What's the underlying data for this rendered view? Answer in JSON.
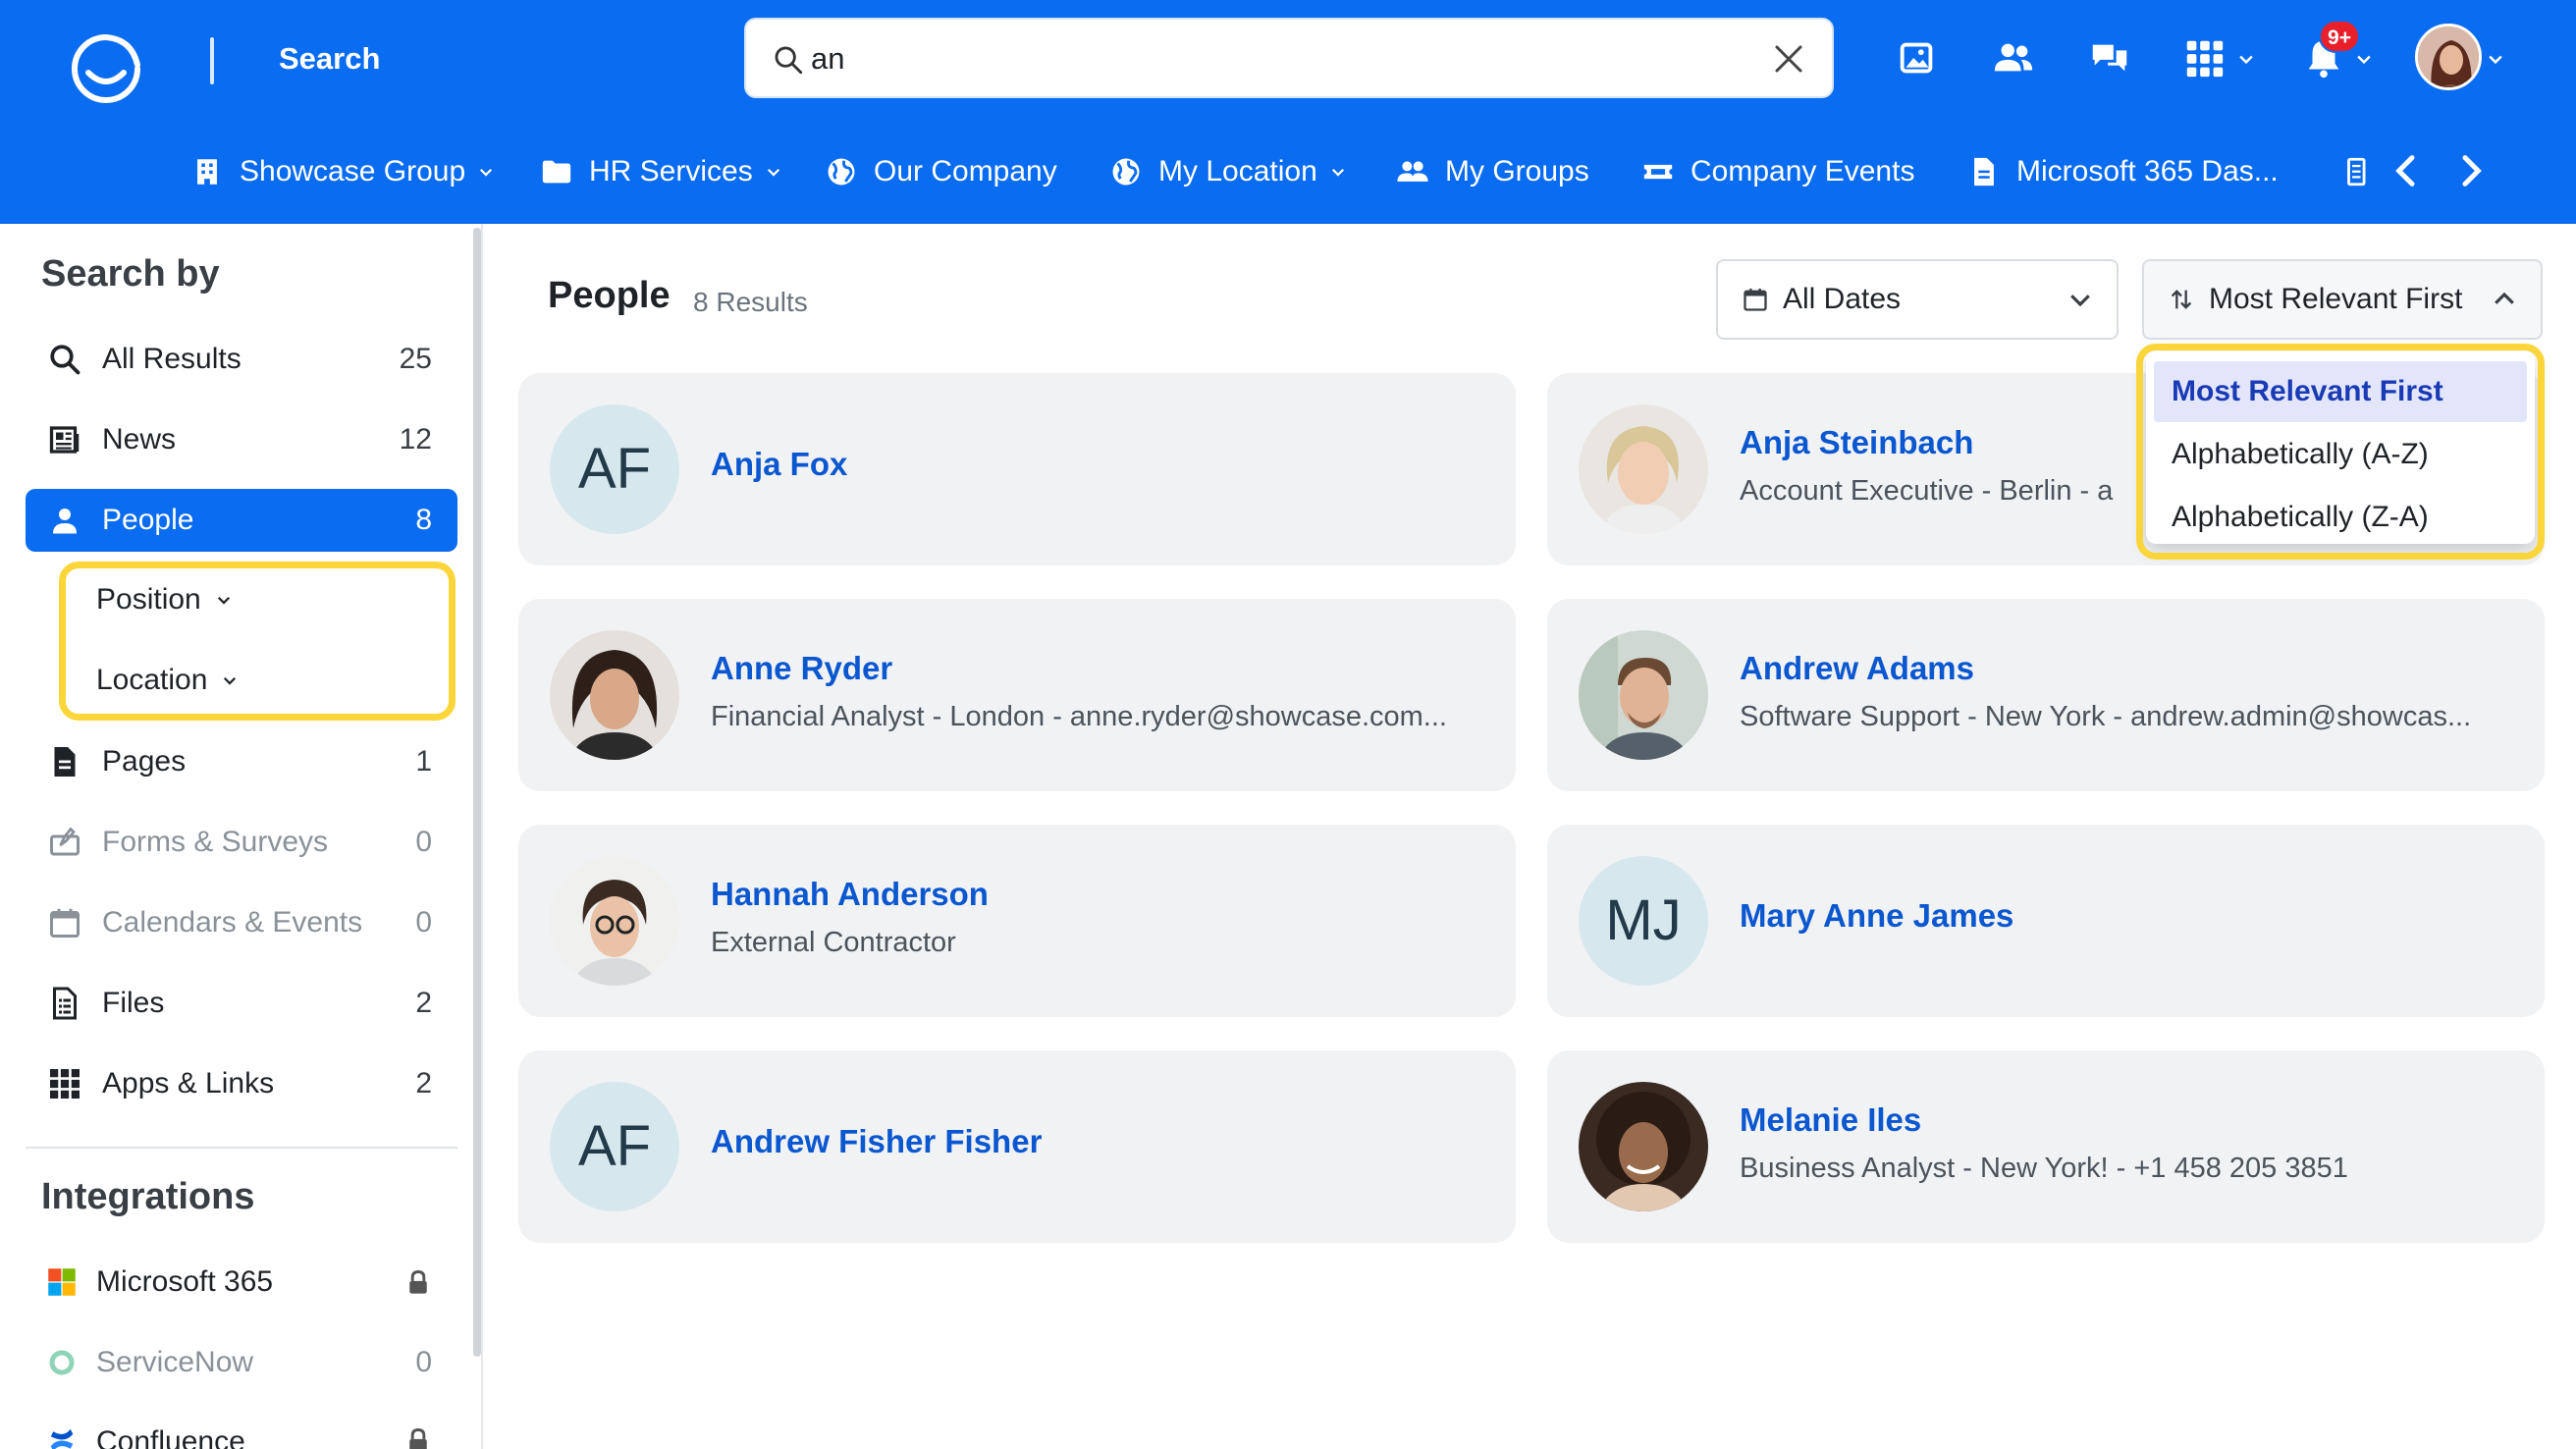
{
  "header": {
    "title": "Search",
    "search": {
      "value": "an",
      "placeholder": ""
    },
    "notification_badge": "9+",
    "brand_color": "#0a6cf0"
  },
  "nav": {
    "items": [
      {
        "label": "Showcase Group",
        "icon": "building-icon",
        "has_dropdown": true
      },
      {
        "label": "HR Services",
        "icon": "folder-icon",
        "has_dropdown": true
      },
      {
        "label": "Our Company",
        "icon": "globe-icon",
        "has_dropdown": false
      },
      {
        "label": "My Location",
        "icon": "globe-icon",
        "has_dropdown": true
      },
      {
        "label": "My Groups",
        "icon": "users-icon",
        "has_dropdown": false
      },
      {
        "label": "Company Events",
        "icon": "ticket-icon",
        "has_dropdown": false
      },
      {
        "label": "Microsoft 365 Das...",
        "icon": "document-icon",
        "has_dropdown": false
      }
    ]
  },
  "sidebar": {
    "heading": "Search by",
    "items": [
      {
        "label": "All Results",
        "count": "25",
        "icon": "search-icon"
      },
      {
        "label": "News",
        "count": "12",
        "icon": "newspaper-icon"
      },
      {
        "label": "People",
        "count": "8",
        "icon": "person-icon",
        "active": true
      },
      {
        "label": "Pages",
        "count": "1",
        "icon": "page-icon"
      },
      {
        "label": "Forms & Surveys",
        "count": "0",
        "icon": "form-icon"
      },
      {
        "label": "Calendars & Events",
        "count": "0",
        "icon": "calendar-icon"
      },
      {
        "label": "Files",
        "count": "2",
        "icon": "file-icon"
      },
      {
        "label": "Apps & Links",
        "count": "2",
        "icon": "grid-icon"
      }
    ],
    "filters": [
      {
        "label": "Position"
      },
      {
        "label": "Location"
      }
    ],
    "integrations_heading": "Integrations",
    "integrations": [
      {
        "label": "Microsoft 365",
        "status": "locked"
      },
      {
        "label": "ServiceNow",
        "count": "0"
      },
      {
        "label": "Confluence",
        "status": "locked"
      }
    ]
  },
  "main": {
    "title": "People",
    "result_count": "8 Results",
    "date_filter": "All Dates",
    "sort": {
      "selected": "Most Relevant First",
      "options": [
        "Most Relevant First",
        "Alphabetically (A-Z)",
        "Alphabetically (Z-A)"
      ]
    },
    "people": [
      {
        "name": "Anja Fox",
        "detail": "",
        "initials": "AF"
      },
      {
        "name": "Anja Steinbach",
        "detail": "Account Executive - Berlin - a",
        "initials": ""
      },
      {
        "name": "Anne Ryder",
        "detail": "Financial Analyst - London - anne.ryder@showcase.com...",
        "initials": ""
      },
      {
        "name": "Andrew Adams",
        "detail": "Software Support - New York - andrew.admin@showcas...",
        "initials": ""
      },
      {
        "name": "Hannah Anderson",
        "detail": "External Contractor",
        "initials": ""
      },
      {
        "name": "Mary Anne James",
        "detail": "",
        "initials": "MJ"
      },
      {
        "name": "Andrew Fisher Fisher",
        "detail": "",
        "initials": "AF"
      },
      {
        "name": "Melanie Iles",
        "detail": "Business Analyst - New York! - +1 458 205 3851",
        "initials": ""
      }
    ]
  },
  "colors": {
    "accent": "#0a6cf0",
    "link": "#0b57d0",
    "highlight": "#fbd53a",
    "card_bg": "#f1f2f4"
  }
}
